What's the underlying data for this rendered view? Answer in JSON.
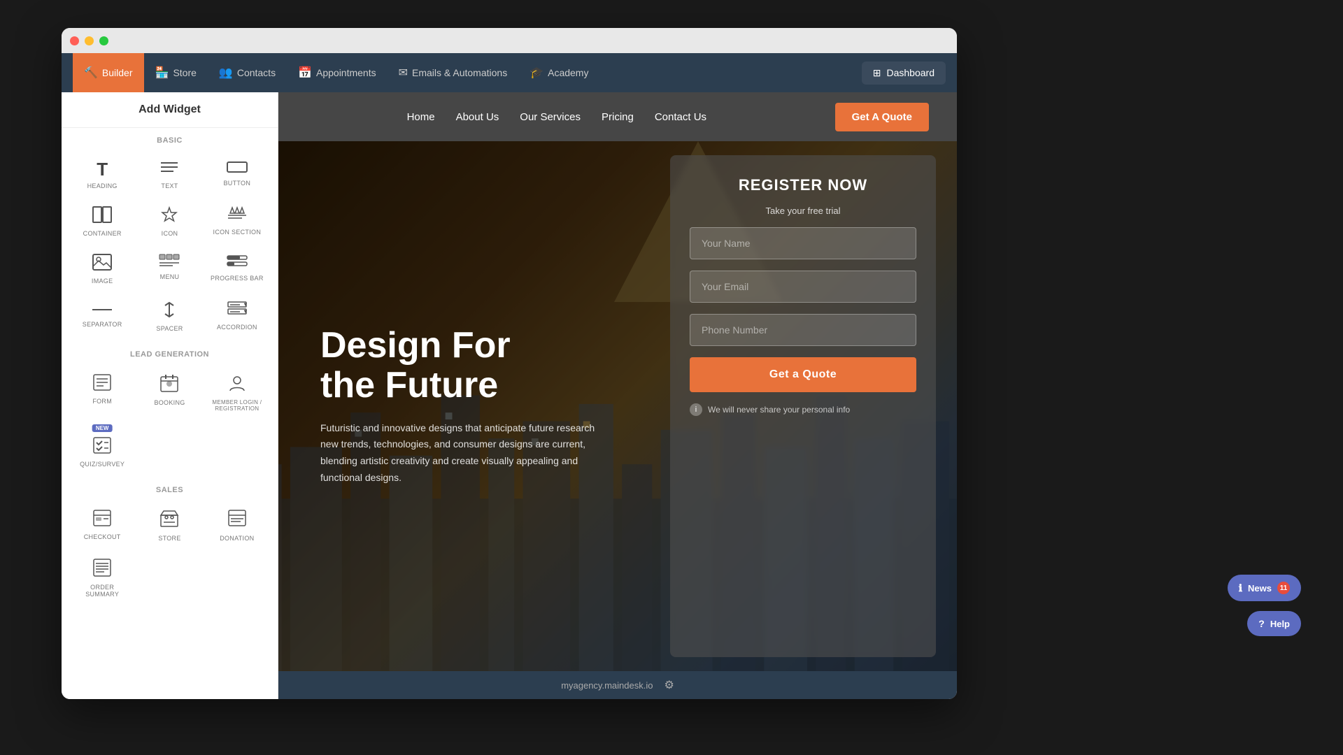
{
  "window": {
    "title": "Add Widget"
  },
  "topNav": {
    "items": [
      {
        "label": "Builder",
        "icon": "🔨",
        "active": true
      },
      {
        "label": "Store",
        "icon": "🏪"
      },
      {
        "label": "Contacts",
        "icon": "👥"
      },
      {
        "label": "Appointments",
        "icon": "📅"
      },
      {
        "label": "Emails & Automations",
        "icon": "✉"
      },
      {
        "label": "Academy",
        "icon": "🎓"
      }
    ],
    "dashboard_label": "Dashboard"
  },
  "sidebar": {
    "title": "Add Widget",
    "sections": [
      {
        "label": "BASIC",
        "widgets": [
          {
            "name": "HEADING",
            "icon": "heading"
          },
          {
            "name": "TEXT",
            "icon": "text"
          },
          {
            "name": "BUTTON",
            "icon": "button"
          },
          {
            "name": "CONTAINER",
            "icon": "container"
          },
          {
            "name": "ICON",
            "icon": "icon"
          },
          {
            "name": "ICON SECTION",
            "icon": "icon-section"
          },
          {
            "name": "IMAGE",
            "icon": "image"
          },
          {
            "name": "MENU",
            "icon": "menu"
          },
          {
            "name": "PROGRESS BAR",
            "icon": "progress"
          },
          {
            "name": "SEPARATOR",
            "icon": "separator"
          },
          {
            "name": "SPACER",
            "icon": "spacer"
          },
          {
            "name": "ACCORDION",
            "icon": "accordion"
          }
        ]
      },
      {
        "label": "LEAD GENERATION",
        "widgets": [
          {
            "name": "FORM",
            "icon": "form"
          },
          {
            "name": "BOOKING",
            "icon": "booking"
          },
          {
            "name": "MEMBER LOGIN / REGISTRATION",
            "icon": "member",
            "new": false
          },
          {
            "name": "QUIZ/SURVEY",
            "icon": "quiz",
            "new": true
          }
        ]
      },
      {
        "label": "SALES",
        "widgets": [
          {
            "name": "CHECKOUT",
            "icon": "checkout"
          },
          {
            "name": "STORE",
            "icon": "store"
          },
          {
            "name": "DONATION",
            "icon": "donation"
          },
          {
            "name": "ORDER SUMMARY",
            "icon": "order"
          }
        ]
      }
    ]
  },
  "siteNav": {
    "links": [
      "Home",
      "About Us",
      "Our Services",
      "Pricing",
      "Contact Us"
    ],
    "cta": "Get A Quote"
  },
  "hero": {
    "title": "Design For\nthe Future",
    "description": "Futuristic and innovative designs that anticipate future research new trends, technologies, and consumer designs are current, blending artistic creativity and create visually appealing and functional designs."
  },
  "form": {
    "title": "REGISTER NOW",
    "subtitle": "Take your free trial",
    "name_placeholder": "Your Name",
    "email_placeholder": "Your Email",
    "phone_placeholder": "Phone Number",
    "submit_label": "Get a Quote",
    "privacy_text": "We will never share your personal info"
  },
  "bottomBar": {
    "url": "myagency.maindesk.io",
    "settings_icon": "⚙"
  },
  "floatingButtons": {
    "news_label": "News",
    "news_count": "11",
    "help_label": "Help"
  }
}
